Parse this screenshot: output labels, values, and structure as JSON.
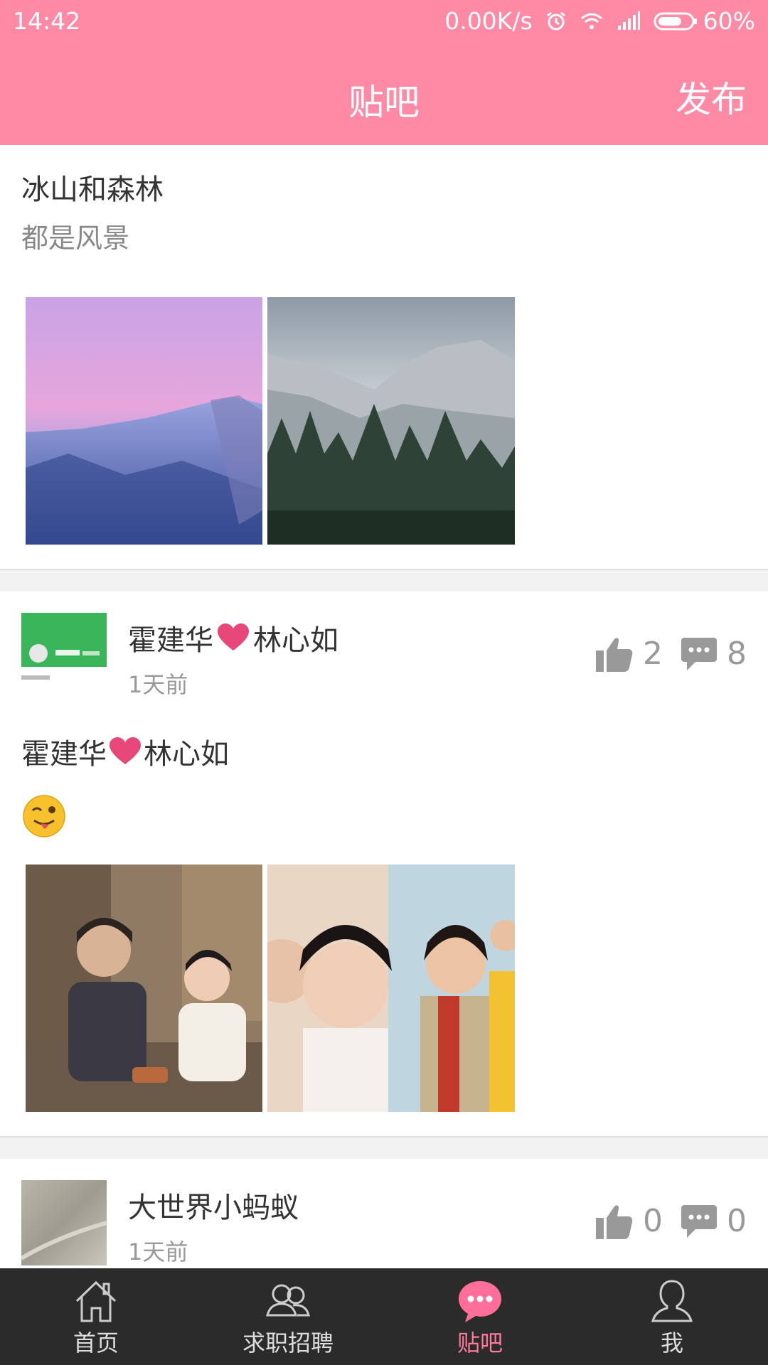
{
  "status": {
    "time": "14:42",
    "network_speed": "0.00K/s",
    "battery": "60%"
  },
  "header": {
    "title": "贴吧",
    "publish_label": "发布"
  },
  "posts": [
    {
      "title": "冰山和森林",
      "subtitle": "都是风景",
      "images": [
        "mountain-dusk-photo",
        "mountain-forest-photo"
      ]
    },
    {
      "author_part1": "霍建华",
      "author_part2": "林心如",
      "time": "1天前",
      "likes": "2",
      "comments": "8",
      "body_part1": "霍建华",
      "body_part2": "林心如",
      "emoji": "winking-tongue-face",
      "images": [
        "couple-photo",
        "couple-selfie-photo"
      ]
    },
    {
      "author": "大世界小蚂蚁",
      "time": "1天前",
      "likes": "0",
      "comments": "0"
    }
  ],
  "tabs": [
    {
      "label": "首页",
      "icon": "home-icon"
    },
    {
      "label": "求职招聘",
      "icon": "people-icon"
    },
    {
      "label": "贴吧",
      "icon": "chat-bubble-icon"
    },
    {
      "label": "我",
      "icon": "person-icon"
    }
  ],
  "colors": {
    "accent": "#ff8aa6",
    "active_tab": "#ff7aa0",
    "tabbar_bg": "#2b2b2b",
    "heart": "#e8477a"
  }
}
